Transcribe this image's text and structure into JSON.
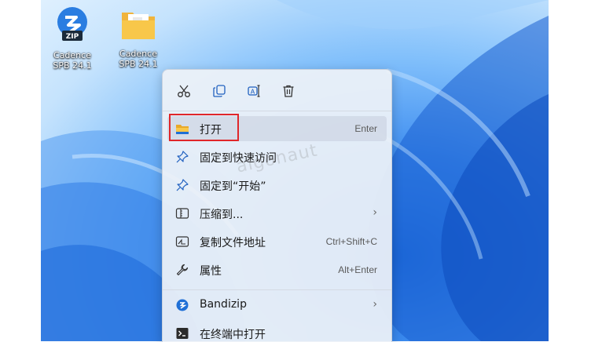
{
  "desktop": {
    "icons": [
      {
        "label_line1": "Cadence",
        "label_line2": "SPB 24.1",
        "icon": "bandizip-zip-icon"
      },
      {
        "label_line1": "Cadence",
        "label_line2": "SPB 24.1",
        "icon": "folder-icon"
      }
    ]
  },
  "context_menu": {
    "toolbar": {
      "cut": "cut-icon",
      "copy": "copy-icon",
      "rename": "rename-icon",
      "delete": "delete-icon"
    },
    "items": [
      {
        "label": "打开",
        "shortcut": "Enter",
        "icon": "folder-icon"
      },
      {
        "label": "固定到快速访问",
        "icon": "pin-icon"
      },
      {
        "label": "固定到“开始”",
        "icon": "pin-icon"
      },
      {
        "label": "压缩到...",
        "icon": "compress-icon",
        "submenu": "›"
      },
      {
        "label": "复制文件地址",
        "shortcut": "Ctrl+Shift+C",
        "icon": "copy-path-icon"
      },
      {
        "label": "属性",
        "shortcut": "Alt+Enter",
        "icon": "wrench-icon"
      },
      {
        "label": "Bandizip",
        "icon": "bandizip-icon",
        "submenu": "›"
      },
      {
        "label": "在终端中打开",
        "icon": "terminal-icon"
      }
    ]
  },
  "watermark": "algonaut",
  "colors": {
    "accent": "#0f6cbd",
    "highlight_box": "#e0262a",
    "folder": "#f8c74a"
  }
}
